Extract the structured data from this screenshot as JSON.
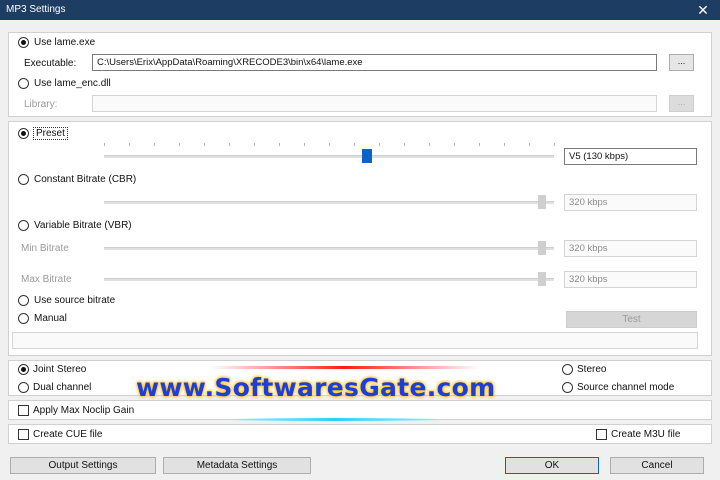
{
  "window": {
    "title": "MP3 Settings",
    "close_glyph": "✕"
  },
  "encoder": {
    "use_lame_exe_label": "Use lame.exe",
    "executable_label": "Executable:",
    "executable_value": "C:\\Users\\Erix\\AppData\\Roaming\\XRECODE3\\bin\\x64\\lame.exe",
    "browse_label": "...",
    "use_lame_enc_label": "Use lame_enc.dll",
    "library_label": "Library:",
    "library_value": "",
    "selected": "lame.exe"
  },
  "bitrate": {
    "preset_label": "Preset",
    "preset_value": "V5 (130 kbps)",
    "preset_position": 0.5,
    "cbr_label": "Constant Bitrate (CBR)",
    "cbr_value": "320 kbps",
    "vbr_label": "Variable Bitrate (VBR)",
    "min_bitrate_label": "Min Bitrate",
    "min_bitrate_value": "320 kbps",
    "max_bitrate_label": "Max Bitrate",
    "max_bitrate_value": "320 kbps",
    "use_source_label": "Use source bitrate",
    "manual_label": "Manual",
    "test_label": "Test",
    "manual_value": "",
    "selected": "Preset"
  },
  "channels": {
    "joint_stereo_label": "Joint Stereo",
    "stereo_label": "Stereo",
    "dual_channel_label": "Dual channel",
    "source_channel_label": "Source channel mode",
    "selected": "Joint Stereo"
  },
  "options": {
    "apply_max_noclip_label": "Apply Max Noclip Gain",
    "create_cue_label": "Create CUE file",
    "create_m3u_label": "Create M3U file"
  },
  "footer": {
    "output_settings_label": "Output Settings",
    "metadata_settings_label": "Metadata Settings",
    "ok_label": "OK",
    "cancel_label": "Cancel"
  },
  "watermark": {
    "text": "www.SoftwaresGate.com"
  },
  "colors": {
    "titlebar": "#1d3d63",
    "accent": "#0a64c8",
    "watermark_text": "#1c3ee0"
  }
}
